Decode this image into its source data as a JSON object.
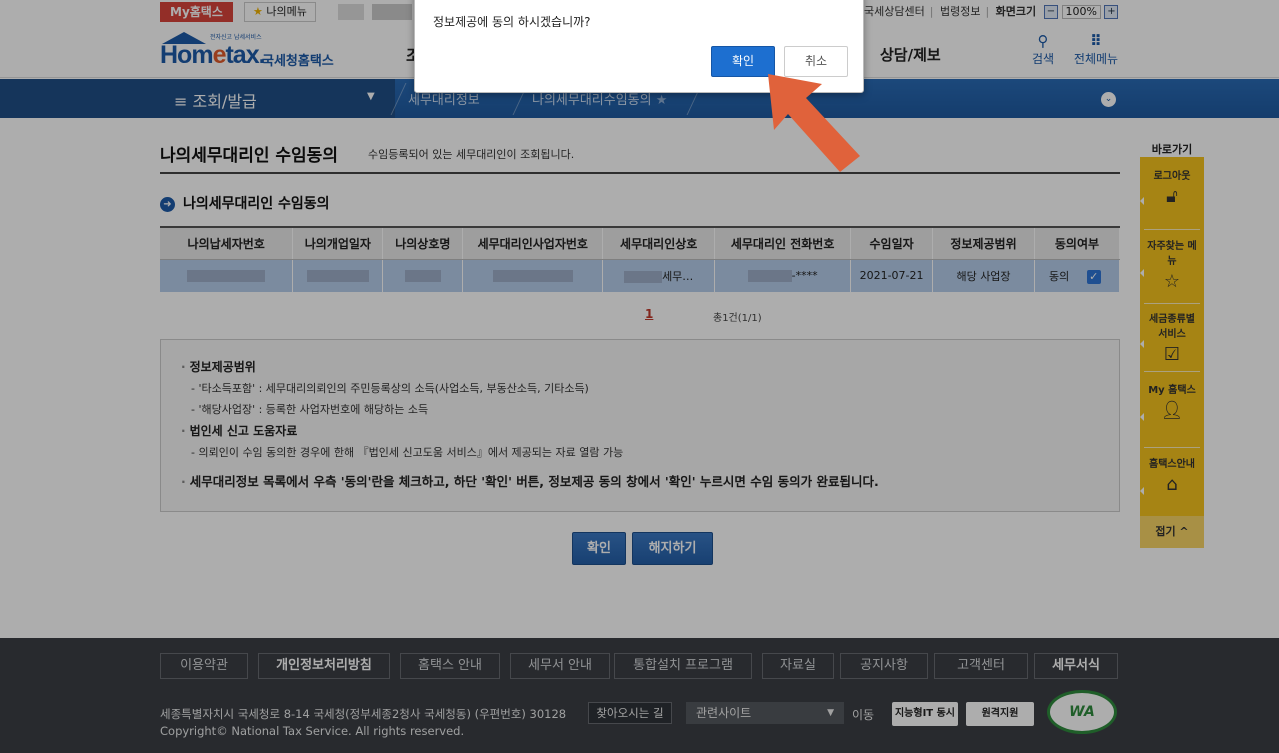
{
  "utility": {
    "my_hometax": "My홈택스",
    "my_menu": "나의메뉴",
    "links": [
      "국세상담센터",
      "법령정보",
      "화면크기"
    ],
    "zoom_minus": "−",
    "zoom_value": "100%",
    "zoom_plus": "+"
  },
  "header": {
    "logo_tiny": "전자신고 납세서비스",
    "logo_word_a": "Hom",
    "logo_word_e": "e",
    "logo_word_b": "tax.",
    "logo_sub": "국세청홈택스",
    "menu_partial": "조",
    "menu_consult": "상담/제보",
    "search_label": "검색",
    "all_menu_label": "전체메뉴"
  },
  "nav": {
    "section": "≡  조회/발급",
    "crumb1": "세무대리정보",
    "crumb2": "나의세무대리수임동의"
  },
  "page": {
    "title": "나의세무대리인 수임동의",
    "description": "수임등록되어 있는 세무대리인이 조회됩니다.",
    "section_title": "나의세무대리인 수임동의"
  },
  "table": {
    "headers": [
      "나의납세자번호",
      "나의개업일자",
      "나의상호명",
      "세무대리인사업자번호",
      "세무대리인상호",
      "세무대리인 전화번호",
      "수임일자",
      "정보제공범위",
      "동의여부"
    ],
    "row": {
      "agent_name_suffix": "세무…",
      "agent_phone_suffix": "-****",
      "date": "2021-07-21",
      "scope": "해당 사업장",
      "consent": "동의"
    }
  },
  "pagination": {
    "current": "1",
    "total": "총1건(1/1)"
  },
  "info": {
    "h1": "정보제공범위",
    "l1": "- '타소득포함' : 세무대리의뢰인의 주민등록상의 소득(사업소득, 부동산소득, 기타소득)",
    "l2": "- '해당사업장' : 등록한 사업자번호에 해당하는 소득",
    "h2": "법인세 신고 도움자료",
    "l3": "- 의뢰인이 수임 동의한 경우에 한해 『법인세 신고도움 서비스』에서 제공되는 자료 열람 가능",
    "note": "세무대리정보 목록에서 우측 '동의'란을 체크하고, 하단 '확인' 버튼, 정보제공 동의 창에서 '확인' 누르시면 수임 동의가 완료됩니다."
  },
  "buttons": {
    "confirm": "확인",
    "terminate": "해지하기"
  },
  "quick": {
    "title": "바로가기",
    "items": [
      "로그아웃",
      "자주찾는 메뉴",
      "세금종류별 서비스",
      "My 홈택스",
      "홈택스안내"
    ],
    "fold": "접기 ^"
  },
  "footer": {
    "nav": [
      "이용약관",
      "개인정보처리방침",
      "홈택스 안내",
      "세무서 안내",
      "통합설치 프로그램",
      "자료실",
      "공지사항",
      "고객센터",
      "세무서식"
    ],
    "address": "세종특별자치시 국세청로 8-14 국세청(정부세종2청사 국세청동) (우편번호) 30128",
    "find_button": "찾아오시는 길",
    "related_sites": "관련사이트",
    "go": "이동",
    "badge1": "지능형IT 동시",
    "badge2": "원격지원",
    "copyright": "Copyright© National Tax Service. All rights reserved.",
    "wa_mark": "WA"
  },
  "dialog": {
    "message": "정보제공에 동의 하시겠습니까?",
    "ok": "확인",
    "cancel": "취소"
  },
  "colors": {
    "brand_blue": "#1c5aa8",
    "accent_red": "#d9443c",
    "quick_yellow": "#f5c31e",
    "row_highlight": "#b6cdea",
    "arrow_orange": "#e0623b"
  }
}
